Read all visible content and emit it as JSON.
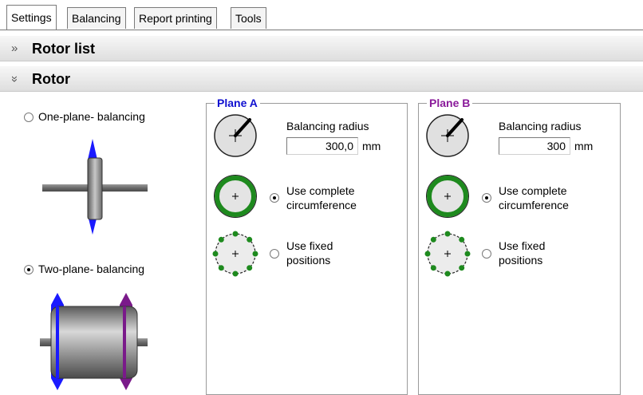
{
  "tabs": [
    "Settings",
    "Balancing",
    "Report printing",
    "Tools"
  ],
  "sections": {
    "rotor_list": "Rotor list",
    "rotor": "Rotor"
  },
  "chevron_collapsed": "»",
  "chevron_expanded": "»",
  "rotor_type": {
    "one_plane": "One-plane- balancing",
    "two_plane": "Two-plane- balancing",
    "selected": "Two-plane- balancing"
  },
  "planes": [
    {
      "title": "Plane A",
      "title_color": "#1010d0",
      "radius_label": "Balancing radius",
      "radius_value": "300,0",
      "unit": "mm",
      "option_complete_line1": "Use complete",
      "option_complete_line2": "circumference",
      "option_fixed_line1": "Use fixed",
      "option_fixed_line2": "positions",
      "selected": "complete"
    },
    {
      "title": "Plane B",
      "title_color": "#8a1a9a",
      "radius_label": "Balancing radius",
      "radius_value": "300",
      "unit": "mm",
      "option_complete_line1": "Use complete",
      "option_complete_line2": "circumference",
      "option_fixed_line1": "Use fixed",
      "option_fixed_line2": "positions",
      "selected": "complete"
    }
  ],
  "colors": {
    "plane_a": "#1a1aff",
    "plane_b": "#7a1a8a",
    "ring": "#1e8a1e",
    "dot": "#1e8a1e"
  },
  "icons": [
    "radius-dial-icon",
    "complete-circumference-icon",
    "fixed-positions-icon",
    "one-plane-rotor-icon",
    "two-plane-rotor-icon"
  ]
}
